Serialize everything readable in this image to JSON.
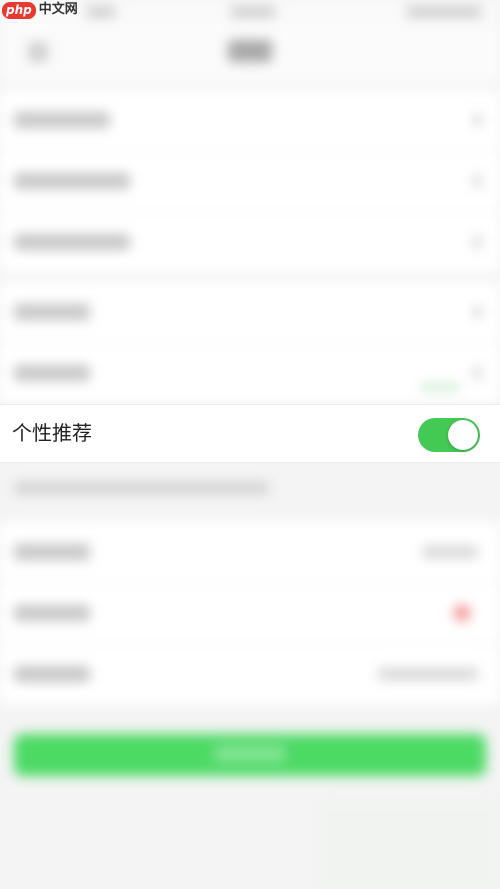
{
  "watermark": {
    "badge": "php",
    "text": "中文网"
  },
  "settings": {
    "personalized_recommendation": {
      "label": "个性推荐",
      "enabled": true
    }
  },
  "colors": {
    "toggle_on": "#44c955",
    "primary_button": "#4cd964",
    "watermark_badge": "#e8382f"
  }
}
